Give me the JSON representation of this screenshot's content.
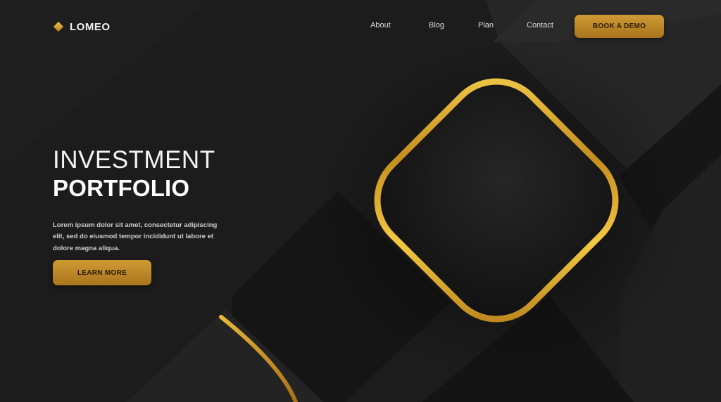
{
  "logo": {
    "icon": "diamond-icon",
    "text": "LOMEO"
  },
  "nav": {
    "items": [
      "About",
      "Blog",
      "Plan",
      "Contact"
    ]
  },
  "header_cta": {
    "label": "BOOK A DEMO"
  },
  "hero": {
    "title_line1": "INVESTMENT",
    "title_line2": "PORTFOLIO",
    "description": "Lorem ipsum dolor sit amet, consectetur adipiscing elit, sed do eiusmod tempor incididunt ut labore et dolore magna aliqua.",
    "cta_label": "LEARN MORE"
  },
  "colors": {
    "background": "#1b1b1b",
    "accent_gold": "#d4a437",
    "text": "#ffffff"
  }
}
